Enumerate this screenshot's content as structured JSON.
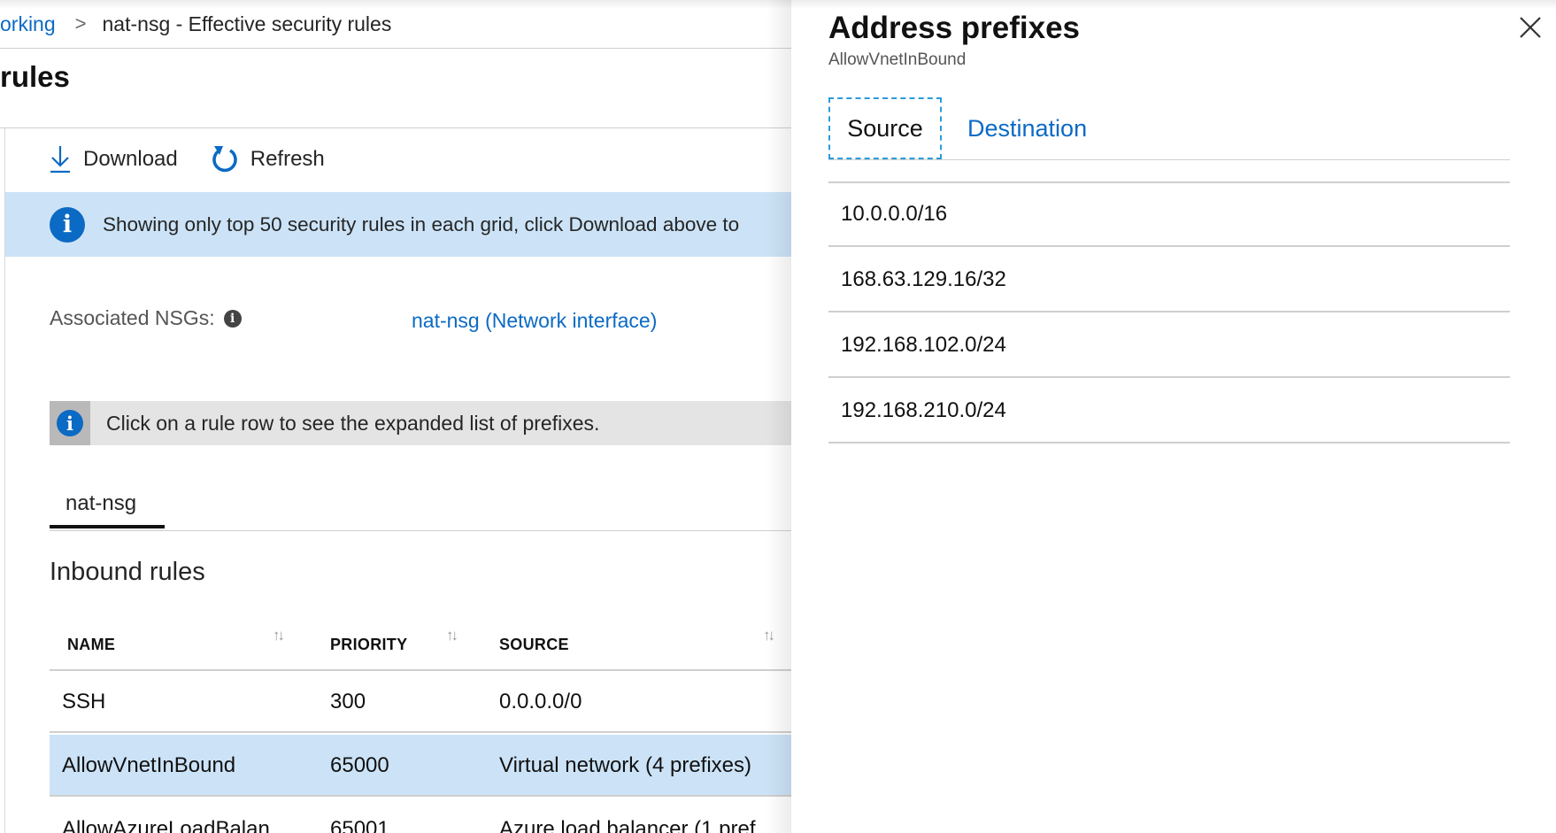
{
  "breadcrumb": {
    "parent": "orking",
    "separator": ">",
    "current": "nat-nsg - Effective security rules"
  },
  "page": {
    "title": "rules"
  },
  "toolbar": {
    "download_label": "Download",
    "refresh_label": "Refresh"
  },
  "info_banner": {
    "text": "Showing only top 50 security rules in each grid, click Download above to"
  },
  "associated": {
    "label": "Associated NSGs:",
    "link": "nat-nsg (Network interface)"
  },
  "hint": {
    "text": "Click on a rule row to see the expanded list of prefixes."
  },
  "nsg_tab": {
    "label": "nat-nsg"
  },
  "inbound": {
    "title": "Inbound rules",
    "columns": [
      "NAME",
      "PRIORITY",
      "SOURCE"
    ],
    "rows": [
      {
        "name": "SSH",
        "priority": "300",
        "source": "0.0.0.0/0"
      },
      {
        "name": "AllowVnetInBound",
        "priority": "65000",
        "source": "Virtual network (4 prefixes)"
      },
      {
        "name": "AllowAzureLoadBalan",
        "priority": "65001",
        "source": "Azure load balancer (1 pref"
      }
    ]
  },
  "panel": {
    "title": "Address prefixes",
    "subtitle": "AllowVnetInBound",
    "tabs": [
      "Source",
      "Destination"
    ],
    "active_tab": "Source",
    "prefixes": [
      "10.0.0.0/16",
      "168.63.129.16/32",
      "192.168.102.0/24",
      "192.168.210.0/24"
    ]
  },
  "colors": {
    "link": "#0b6ac4",
    "info_banner_bg": "#cce3f7",
    "selected_row_bg": "#cce3f7",
    "hint_bg": "#e4e4e4",
    "focus_outline": "#2b9bdb"
  },
  "icons": [
    "download-icon",
    "refresh-icon",
    "info-icon",
    "close-icon",
    "sort-icon"
  ]
}
